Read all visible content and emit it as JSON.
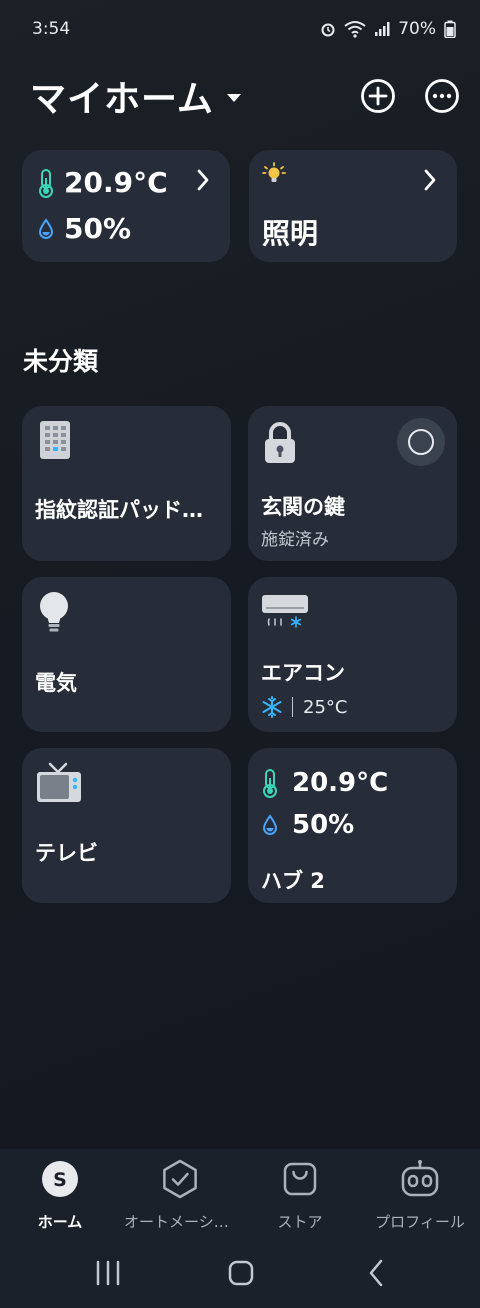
{
  "status_bar": {
    "time": "3:54",
    "battery": "70%"
  },
  "header": {
    "title": "マイホーム"
  },
  "summary": {
    "climate": {
      "temperature": "20.9°C",
      "humidity": "50%"
    },
    "lighting": {
      "label": "照明"
    }
  },
  "section": {
    "title": "未分類"
  },
  "devices": [
    {
      "name": "指紋認証パッド…",
      "icon": "keypad-icon"
    },
    {
      "name": "玄関の鍵",
      "status": "施錠済み",
      "icon": "lock-icon"
    },
    {
      "name": "電気",
      "icon": "bulb-icon"
    },
    {
      "name": "エアコン",
      "mode": "cool",
      "temperature": "25°C",
      "icon": "air-conditioner-icon"
    },
    {
      "name": "テレビ",
      "icon": "tv-icon"
    },
    {
      "name": "ハブ 2",
      "temperature": "20.9°C",
      "humidity": "50%",
      "icon": "hub-icon"
    }
  ],
  "nav": [
    {
      "label": "ホーム",
      "icon": "home-s-icon",
      "active": true
    },
    {
      "label": "オートメーション",
      "icon": "automation-icon",
      "active": false
    },
    {
      "label": "ストア",
      "icon": "store-icon",
      "active": false
    },
    {
      "label": "プロフィール",
      "icon": "profile-robot-icon",
      "active": false
    }
  ],
  "colors": {
    "card": "#262d38",
    "background": "#171b22",
    "thermo": "#3dd6b8",
    "drop": "#4aa3ff",
    "accent_blue": "#35b6ff"
  }
}
